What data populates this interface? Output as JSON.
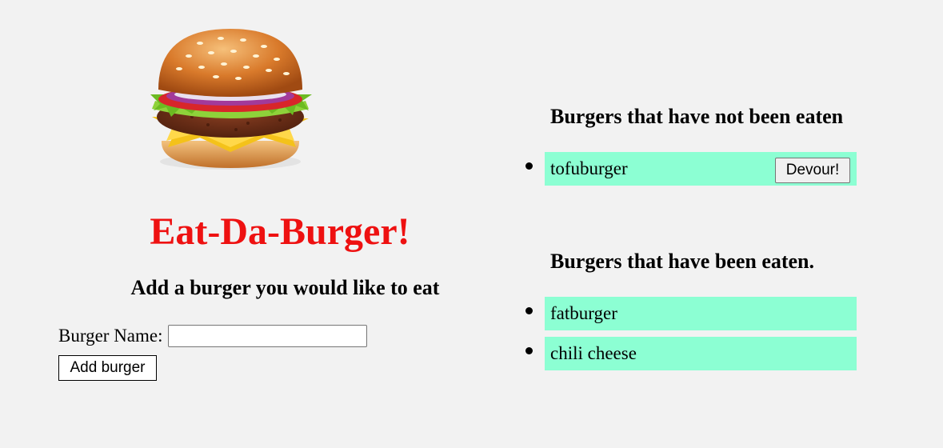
{
  "header": {
    "logo_icon": "hamburger-icon",
    "title": "Eat-Da-Burger!",
    "title_color": "#ee1111"
  },
  "form": {
    "heading": "Add a burger you would like to eat",
    "name_label": "Burger Name:",
    "name_value": "",
    "name_placeholder": "",
    "submit_label": "Add burger"
  },
  "uneaten": {
    "heading": "Burgers that have not been eaten",
    "items": [
      {
        "name": "tofuburger",
        "action_label": "Devour!"
      }
    ]
  },
  "eaten": {
    "heading": "Burgers that have been eaten.",
    "items": [
      {
        "name": "fatburger"
      },
      {
        "name": "chili cheese"
      }
    ]
  },
  "colors": {
    "background": "#f2f2f2",
    "item_background": "#8cffd3"
  }
}
